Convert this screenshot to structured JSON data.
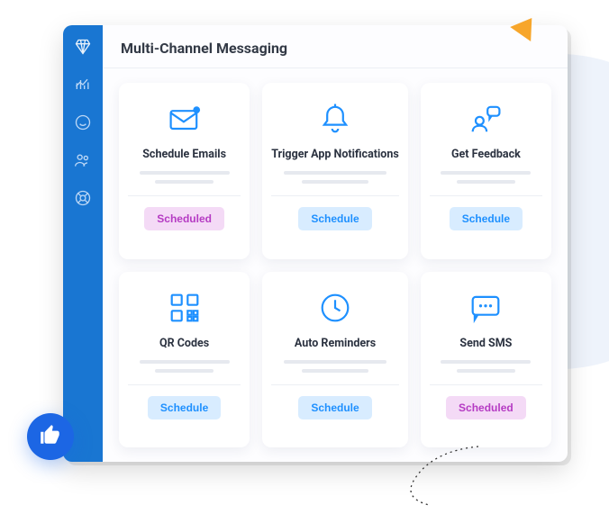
{
  "header": {
    "title": "Multi-Channel Messaging"
  },
  "buttons": {
    "schedule": "Schedule",
    "scheduled": "Scheduled"
  },
  "cards": [
    {
      "title": "Schedule Emails",
      "state": "scheduled"
    },
    {
      "title": "Trigger App Notifications",
      "state": "schedule"
    },
    {
      "title": "Get Feedback",
      "state": "schedule"
    },
    {
      "title": "QR Codes",
      "state": "schedule"
    },
    {
      "title": "Auto Reminders",
      "state": "schedule"
    },
    {
      "title": "Send SMS",
      "state": "scheduled"
    }
  ],
  "colors": {
    "accent": "#1e90ff",
    "sidebar": "#1976d2",
    "scheduled_bg": "#f4daf6",
    "scheduled_fg": "#b53bc3",
    "schedule_bg": "#d8ecff",
    "schedule_fg": "#1e90ff"
  }
}
